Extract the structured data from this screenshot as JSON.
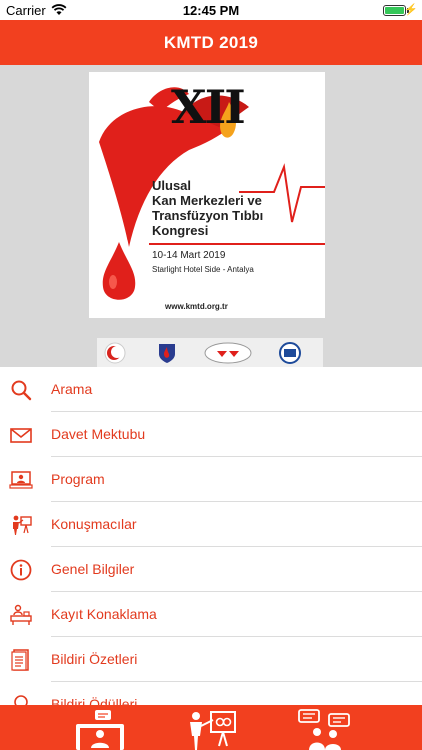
{
  "status_bar": {
    "carrier": "Carrier",
    "time": "12:45 PM",
    "battery_level": 1.0
  },
  "nav": {
    "title": "KMTD 2019"
  },
  "poster": {
    "roman": "XII",
    "title_line1": "Ulusal",
    "title_line2": "Kan Merkezleri ve",
    "title_line3": "Transfüzyon Tıbbı",
    "title_line4": "Kongresi",
    "dates": "10-14 Mart 2019",
    "venue": "Starlight Hotel Side - Antalya",
    "url": "www.kmtd.org.tr"
  },
  "menu": {
    "items": [
      {
        "label": "Arama",
        "icon": "search-icon"
      },
      {
        "label": "Davet Mektubu",
        "icon": "envelope-icon"
      },
      {
        "label": "Program",
        "icon": "program-icon"
      },
      {
        "label": "Konuşmacılar",
        "icon": "speaker-icon"
      },
      {
        "label": "Genel Bilgiler",
        "icon": "info-icon"
      },
      {
        "label": "Kayıt Konaklama",
        "icon": "registration-icon"
      },
      {
        "label": "Bildiri Özetleri",
        "icon": "document-icon"
      },
      {
        "label": "Bildiri Ödülleri",
        "icon": "award-icon"
      }
    ]
  },
  "tab_bar": {
    "tabs": [
      {
        "icon": "computer-user-icon"
      },
      {
        "icon": "presenter-icon"
      },
      {
        "icon": "discussion-icon"
      }
    ]
  },
  "colors": {
    "brand": "#f2401f",
    "menu_text": "#e23a1e"
  }
}
